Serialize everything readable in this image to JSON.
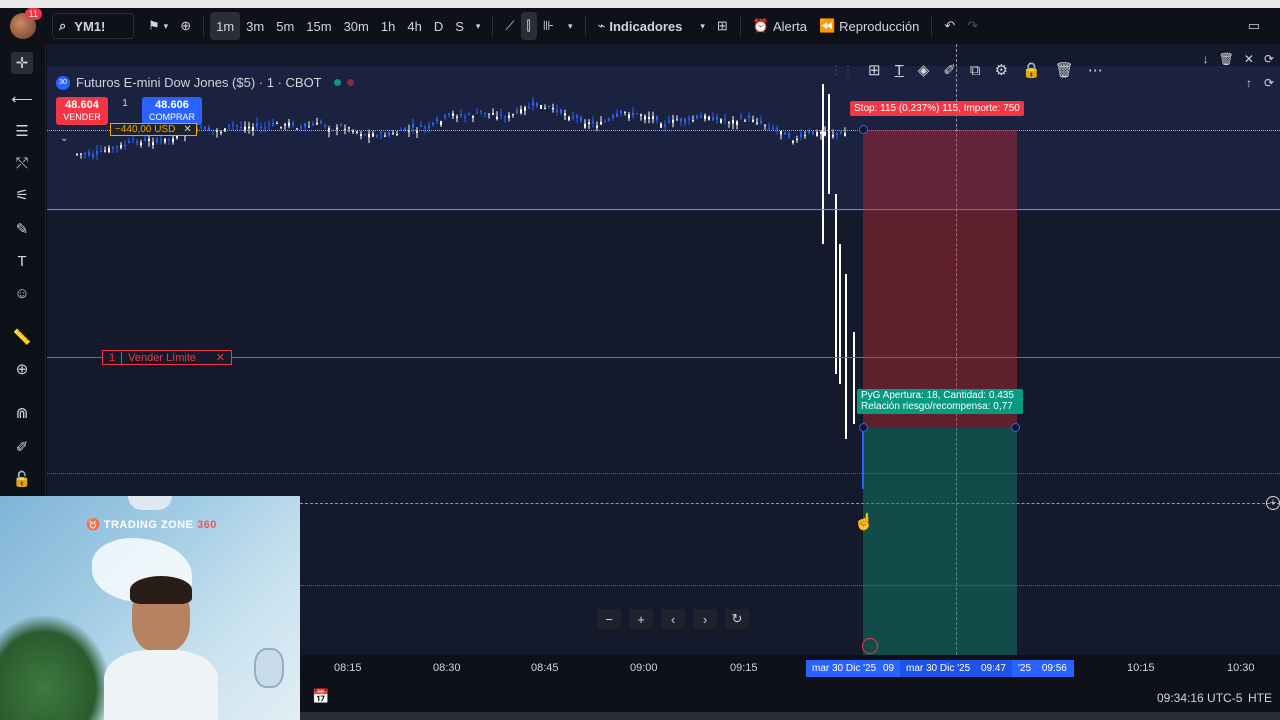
{
  "toolbar": {
    "badge": "11",
    "symbol": "YM1!",
    "intervals": [
      "1m",
      "3m",
      "5m",
      "15m",
      "30m",
      "1h",
      "4h",
      "D",
      "S"
    ],
    "active_interval": "1m",
    "indicators_label": "Indicadores",
    "alert_label": "Alerta",
    "replay_label": "Reproducción"
  },
  "legend": {
    "title": "Futuros E-mini Dow Jones ($5) · 1 · CBOT",
    "logo": "30"
  },
  "trade": {
    "sell_price": "48.604",
    "sell_label": "VENDER",
    "qty": "1",
    "buy_price": "48.606",
    "buy_label": "COMPRAR",
    "pnl": "−440,00 USD",
    "order_qty": "1",
    "order_label": "Vender Límite"
  },
  "position_tool": {
    "stop_label": "Stop: 115 (0,237%) 115, Importe: 750",
    "pyg_line1": "PyG Apertura: 18, Cantidad: 0.435",
    "pyg_line2": "Relación riesgo/recompensa: 0,77",
    "colors": {
      "stop": "#f23645",
      "target": "#089981"
    }
  },
  "time_axis": {
    "ticks": [
      "08:15",
      "08:30",
      "08:45",
      "09:00",
      "09:15",
      "10:15",
      "10:30"
    ],
    "highlight_start": "mar 30 Dic '25",
    "highlight_mid": "09",
    "highlight_center": "mar 30 Dic '25",
    "highlight_center_time": "09:47",
    "highlight_end": "'25",
    "highlight_end_time": "09:56"
  },
  "status": {
    "clock": "09:34:16 UTC-5",
    "session": "HTE"
  },
  "webcam": {
    "brand": "TRADING ZONE",
    "brand_suffix": "360"
  }
}
